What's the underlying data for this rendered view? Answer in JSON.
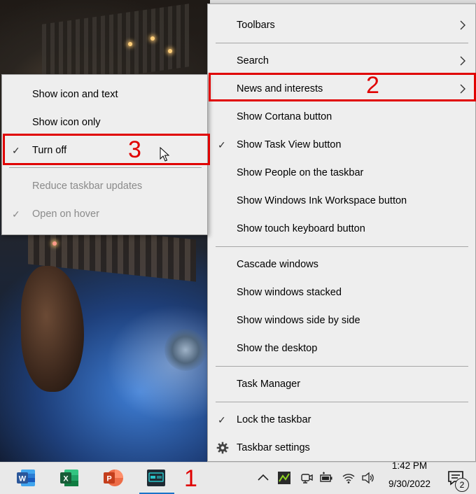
{
  "main_menu": {
    "items": [
      {
        "label": "Toolbars"
      },
      {
        "label": "Search"
      },
      {
        "label": "News and interests"
      },
      {
        "label": "Show Cortana button"
      },
      {
        "label": "Show Task View button"
      },
      {
        "label": "Show People on the taskbar"
      },
      {
        "label": "Show Windows Ink Workspace button"
      },
      {
        "label": "Show touch keyboard button"
      },
      {
        "label": "Cascade windows"
      },
      {
        "label": "Show windows stacked"
      },
      {
        "label": "Show windows side by side"
      },
      {
        "label": "Show the desktop"
      },
      {
        "label": "Task Manager"
      },
      {
        "label": "Lock the taskbar"
      },
      {
        "label": "Taskbar settings"
      }
    ],
    "check_glyph": "✓",
    "checked_items": [
      "Show Task View button",
      "Lock the taskbar"
    ]
  },
  "submenu": {
    "items": [
      {
        "label": "Show icon and text"
      },
      {
        "label": "Show icon only"
      },
      {
        "label": "Turn off"
      },
      {
        "label": "Reduce taskbar updates"
      },
      {
        "label": "Open on hover"
      }
    ],
    "check_glyph": "✓",
    "checked_items": [
      "Turn off",
      "Open on hover"
    ],
    "disabled_items": [
      "Reduce taskbar updates",
      "Open on hover"
    ]
  },
  "annotations": {
    "step1": "1",
    "step2": "2",
    "step3": "3",
    "color": "#e00000"
  },
  "taskbar": {
    "apps": [
      {
        "name": "word-app-icon",
        "letter": "W",
        "color": "#2b579a"
      },
      {
        "name": "excel-app-icon",
        "letter": "X",
        "color": "#217346"
      },
      {
        "name": "powerpoint-app-icon",
        "letter": "P",
        "color": "#d24726"
      },
      {
        "name": "news-app-icon",
        "letter": "TUBE",
        "color": "#1f2a33"
      }
    ],
    "clock": {
      "time": "1:42 PM",
      "date": "9/30/2022"
    },
    "notification_count": "2",
    "active_indicator_color": "#1a73c9"
  },
  "colors": {
    "menu_bg": "#eeeeee",
    "menu_border": "#a0a0a0",
    "disabled_text": "#8a8a8a",
    "taskbar_bg": "#e9e9e9"
  }
}
